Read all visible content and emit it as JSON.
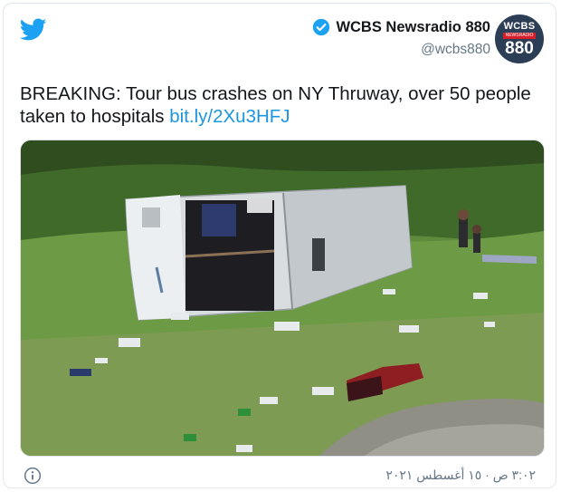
{
  "tweet": {
    "account": {
      "display_name": "WCBS Newsradio 880",
      "handle": "@wcbs880",
      "verified": true,
      "avatar": {
        "line1": "WCBS",
        "line2": "NEWSRADIO",
        "line3": "880",
        "bg_color": "#2c3e55"
      }
    },
    "text": "BREAKING: Tour bus crashes on NY Thruway, over 50 people taken to hospitals",
    "link_text": "bit.ly/2Xu3HFJ",
    "image": {
      "subject": "overturned-tour-bus"
    },
    "timestamp": "٣:٠٢ ص · ١٥ أغسطس ٢٠٢١"
  },
  "icons": {
    "brand": "twitter-bird-icon",
    "verified": "verified-badge-icon",
    "info": "info-icon"
  },
  "colors": {
    "twitter_blue": "#1da1f2",
    "link": "#1b95e0",
    "secondary_text": "#657786",
    "avatar_red": "#d61f2a"
  }
}
